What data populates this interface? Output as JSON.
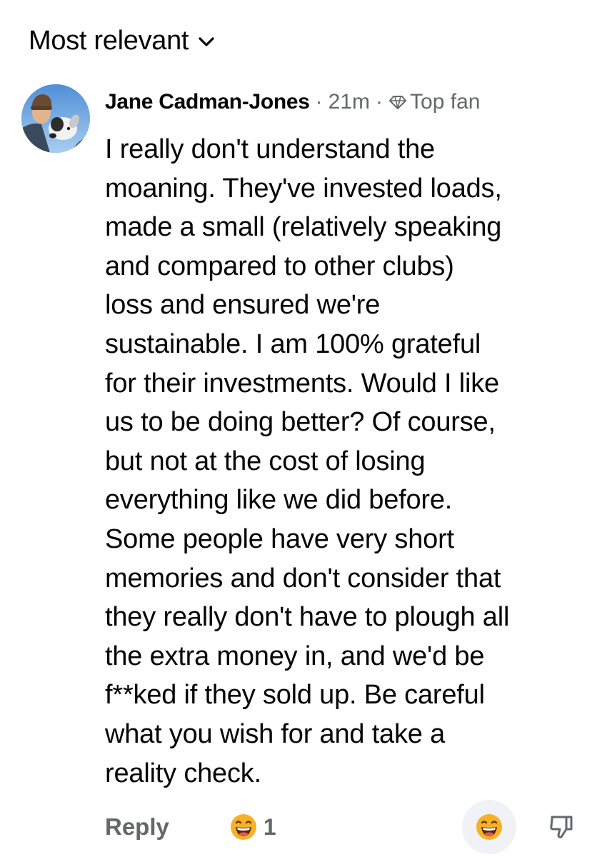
{
  "sort": {
    "label": "Most relevant",
    "icon": "chevron-down-icon"
  },
  "comment": {
    "author": "Jane Cadman-Jones",
    "separator": "·",
    "time": "21m",
    "badge_label": "Top fan",
    "badge_icon": "diamond-icon",
    "avatar_icon": "avatar",
    "text": "I really don't understand the\nmoaning.  They've invested loads,\nmade a small (relatively speaking\nand compared to other clubs)\nloss and ensured we're\nsustainable.  I am 100% grateful\nfor their investments.  Would I like\nus to be doing better? Of course,\nbut not at the cost of losing\neverything like we did before.\nSome people have very short\nmemories and don't consider that\nthey really don't have to plough all\nthe extra money in, and we'd be\nf**ked if they sold up.  Be careful\nwhat you wish for and take a\nreality check."
  },
  "actions": {
    "reply_label": "Reply",
    "reaction_icon": "laughing-emoji-icon",
    "reaction_count": "1",
    "react_button_icon": "laughing-emoji-icon",
    "dislike_icon": "thumbs-down-icon"
  },
  "colors": {
    "text_primary": "#050505",
    "text_secondary": "#65676b",
    "button_bg": "#f0f2f5",
    "emoji_yellow": "#f7b125"
  }
}
